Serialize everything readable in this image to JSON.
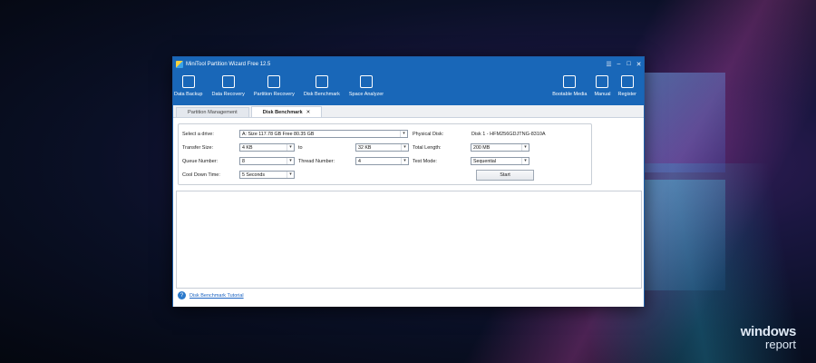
{
  "window": {
    "title": "MiniTool Partition Wizard Free 12.5",
    "controls": {
      "menu": "☰",
      "minimize": "–",
      "maximize": "□",
      "close": "✕"
    }
  },
  "toolbar": {
    "left": [
      {
        "label": "Data Backup",
        "icon": "data-backup-icon"
      },
      {
        "label": "Data Recovery",
        "icon": "data-recovery-icon"
      },
      {
        "label": "Partition Recovery",
        "icon": "partition-recovery-icon"
      },
      {
        "label": "Disk Benchmark",
        "icon": "disk-benchmark-icon"
      },
      {
        "label": "Space Analyzer",
        "icon": "space-analyzer-icon"
      }
    ],
    "right": [
      {
        "label": "Bootable Media",
        "icon": "bootable-media-icon"
      },
      {
        "label": "Manual",
        "icon": "manual-icon"
      },
      {
        "label": "Register",
        "icon": "register-icon"
      }
    ]
  },
  "tabs": [
    {
      "label": "Partition Management",
      "active": false
    },
    {
      "label": "Disk Benchmark",
      "active": true,
      "close": "✕"
    }
  ],
  "benchmark": {
    "select_drive_label": "Select a drive:",
    "drive_value": "A:  Size 117.78 GB  Free 80.35 GB",
    "physical_disk_label": "Physical Disk:",
    "physical_disk_value": "Disk 1 - HFM256GDJTNG-8310A",
    "transfer_size_label": "Transfer Size:",
    "transfer_size_from": "4 KB",
    "to_label": "to",
    "transfer_size_to": "32 KB",
    "total_length_label": "Total Length:",
    "total_length_value": "200 MB",
    "queue_number_label": "Queue Number:",
    "queue_number_value": "8",
    "thread_number_label": "Thread Number:",
    "thread_number_value": "4",
    "test_mode_label": "Test Mode:",
    "test_mode_value": "Sequential",
    "cool_down_label": "Cool Down Time:",
    "cool_down_value": "5 Seconds",
    "start_label": "Start",
    "dropdown_arrow": "▾"
  },
  "footer": {
    "help_glyph": "?",
    "tutorial_link": "Disk Benchmark Tutorial"
  },
  "watermark": {
    "line1": "windows",
    "line2": "report"
  },
  "colors": {
    "accent": "#1967b8",
    "link": "#1a63c2"
  }
}
